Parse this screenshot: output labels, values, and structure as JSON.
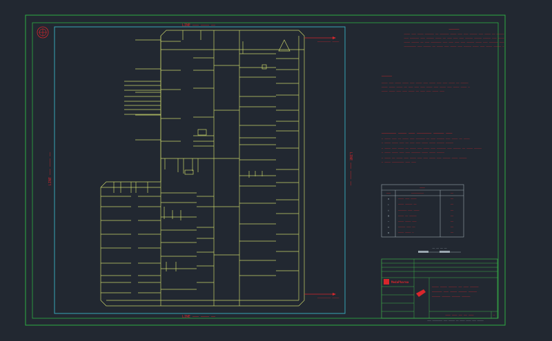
{
  "colors": {
    "background": "#222831",
    "border_outer": "#2fae43",
    "border_inner": "#36a6b8",
    "pipe": "#c9d46a",
    "text_red": "#d8262c",
    "table_line": "#9aa7b0",
    "title_green": "#3fb34a"
  },
  "labels": {
    "top_edge": "LINE ─── ──── ──",
    "bottom_edge": "LINE ─── ──── ──",
    "left_edge": "LINE ─── ──── ──",
    "right_edge": "LINE ─── ──── ──",
    "inlet_top": "──────── ────",
    "inlet_bottom": "──────── ────"
  },
  "general_notes": {
    "title": "─────",
    "lines": [
      "──── ─── ──── ────── ── ────── ──── ─── ─── ───── ─── ──── ── ─────",
      "─── ────── ─── ───── ──── ── ─── ─── ─── ───── ───── ───── ─── ────",
      "──── ───── ── ─── ─────── ─── ─── ─── ─── ───── ──── ─── ────── ───",
      "──────── ─── ───── ── ──── ─── ──── ─── ───── ──── ─── ──── ───── ─"
    ]
  },
  "legend": {
    "title": "─────",
    "lines": [
      "──── ─── ──── ──── ─── ──── ─── ──── ─── ─── ──── ── ─────",
      "──── ──── ──── ── ─── ─── ─── ──── ─── ──── ─── ──── ──── ─",
      "──── ──── ─── ─── ──── ── ─── ─── ──── ───"
    ]
  },
  "reference_notes": {
    "title": "─────── ──── ─── ─────── ───── ───",
    "lines": [
      "─ ──── ─── ── ──── ─── ────── ── ─── ───── ─── ──── ── ────",
      "─ ──── ──── ─── ── ─── ─── ──── ──── ───── ─────",
      "─ ──── ─── ──── ── ──── ─── ──── ─── ────── ─── ───── ── ──── ─────",
      "─ ──── ──── ─── ─── ────── ──── ──── ─────",
      "─ ──── ── ──── ─── ──── ─── ─── ──── ─── ───── ──── ─────",
      "─ ──── ──────── ─── ───"
    ]
  },
  "symbol_table": {
    "title": "───",
    "headers": [
      "───",
      "─────────",
      "──"
    ],
    "rows": [
      {
        "sym": "⊕",
        "desc": "──── ─── ────",
        "val": "──"
      },
      {
        "sym": "▸",
        "desc": "──── ───── ──",
        "val": "──"
      },
      {
        "sym": "◇",
        "desc": "────── ─── ────",
        "val": "──"
      },
      {
        "sym": "⊞",
        "desc": "──── ── ─────",
        "val": "──"
      },
      {
        "sym": "─",
        "desc": "──── ──── ───",
        "val": "──"
      },
      {
        "sym": "═",
        "desc": "───── ─── ──",
        "val": "──"
      },
      {
        "sym": "▬",
        "desc": "──── ──── ─",
        "val": "──"
      }
    ]
  },
  "scale_bar": {
    "label": "── ── ── ──"
  },
  "title_block": {
    "company": "MedaPharma",
    "project_lines": [
      "──── ──── ───── ── ─── ─────",
      "────── ─── ──── ───── ─────",
      "───── ───── ───── ─────"
    ],
    "drawing_no": "─── ─── ── ── ───",
    "sheet": "─",
    "footer": "─── ──────── ─── ───── ── ──── ──── ─── ─────"
  }
}
